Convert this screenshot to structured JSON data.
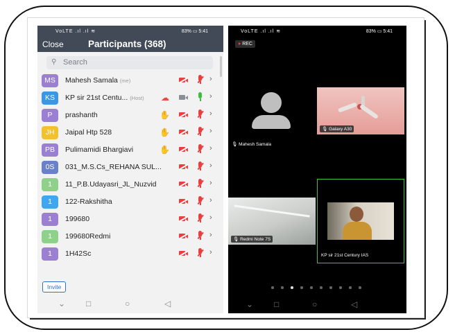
{
  "status_bar": {
    "left_icons": "VoLTE  .ıl  .ıl  ≋",
    "right_text": "83% ▭ 5:41"
  },
  "participants_panel": {
    "close_label": "Close",
    "title": "Participants (368)",
    "search_placeholder": "Search",
    "invite_label": "Invite",
    "participants": [
      {
        "initials": "MS",
        "name": "Mahesh Samala",
        "tag": "(me)",
        "color": "#9b7fd3",
        "hand": false,
        "cloud": false,
        "video_on": false,
        "mic_on": false
      },
      {
        "initials": "KS",
        "name": "KP sir 21st Centu...",
        "tag": "(Host)",
        "color": "#3b97e3",
        "hand": false,
        "cloud": true,
        "video_on": true,
        "mic_on": true
      },
      {
        "initials": "P",
        "name": "prashanth",
        "tag": "",
        "color": "#9b7fd3",
        "hand": true,
        "cloud": false,
        "video_on": false,
        "mic_on": false
      },
      {
        "initials": "JH",
        "name": "Jaipal Htp 528",
        "tag": "",
        "color": "#f2c12e",
        "hand": true,
        "cloud": false,
        "video_on": false,
        "mic_on": false
      },
      {
        "initials": "PB",
        "name": "Pulimamidi Bhargiavi",
        "tag": "",
        "color": "#9b7fd3",
        "hand": true,
        "cloud": false,
        "video_on": false,
        "mic_on": false
      },
      {
        "initials": "0S",
        "name": "031_M.S.Cs_REHANA SUL...",
        "tag": "",
        "color": "#6a80c8",
        "hand": false,
        "cloud": false,
        "video_on": false,
        "mic_on": false
      },
      {
        "initials": "1",
        "name": "11_P.B.Udayasri_JL_Nuzvid",
        "tag": "",
        "color": "#8fd18b",
        "hand": false,
        "cloud": false,
        "video_on": false,
        "mic_on": false
      },
      {
        "initials": "1",
        "name": "122-Rakshitha",
        "tag": "",
        "color": "#40a6ee",
        "hand": false,
        "cloud": false,
        "video_on": false,
        "mic_on": false
      },
      {
        "initials": "1",
        "name": "199680",
        "tag": "",
        "color": "#9b7fd3",
        "hand": false,
        "cloud": false,
        "video_on": false,
        "mic_on": false
      },
      {
        "initials": "1",
        "name": "199680Redmi",
        "tag": "",
        "color": "#8fd18b",
        "hand": false,
        "cloud": false,
        "video_on": false,
        "mic_on": false
      },
      {
        "initials": "1",
        "name": "1H42Sc",
        "tag": "",
        "color": "#9b7fd3",
        "hand": false,
        "cloud": false,
        "video_on": false,
        "mic_on": false
      }
    ]
  },
  "meeting_view": {
    "rec_label": "REC",
    "tiles": [
      {
        "name": "Mahesh Samala",
        "kind": "avatar"
      },
      {
        "name": "Galaxy A30",
        "kind": "ceiling-fan"
      },
      {
        "name": "Redmi Note 7S",
        "kind": "ceiling"
      },
      {
        "name": "KP sir 21st Century IAS",
        "kind": "speaker",
        "active": true,
        "border_color": "#3ec43e"
      }
    ],
    "page_count": 10,
    "active_page": 3
  },
  "nav_icons": [
    "chevron-down-icon",
    "square-icon",
    "circle-icon",
    "back-triangle-icon"
  ]
}
